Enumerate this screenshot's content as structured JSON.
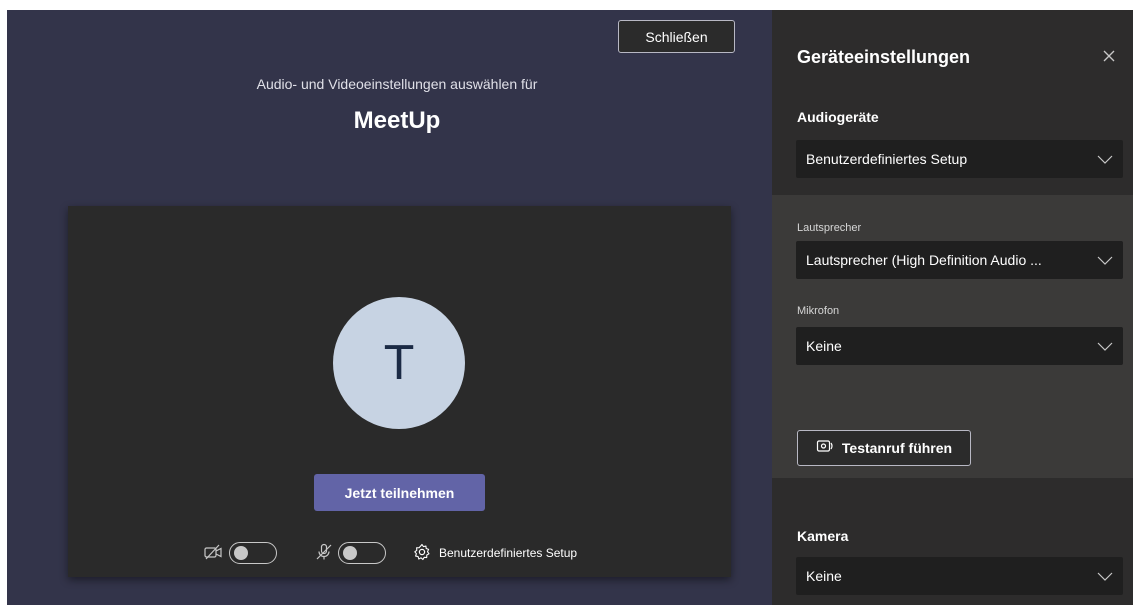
{
  "main": {
    "close_label": "Schließen",
    "subtitle": "Audio- und Videoeinstellungen auswählen für",
    "meeting_title": "MeetUp",
    "avatar_initial": "T",
    "join_label": "Jetzt teilnehmen",
    "camera_toggle": {
      "icon": "camera-off-icon",
      "on": false
    },
    "mic_toggle": {
      "icon": "mic-off-icon",
      "on": false
    },
    "setup_label": "Benutzerdefiniertes Setup",
    "setup_icon": "gear-icon"
  },
  "panel": {
    "title": "Geräteeinstellungen",
    "close_icon": "close-icon",
    "audio": {
      "label": "Audiogeräte",
      "value": "Benutzerdefiniertes Setup"
    },
    "speaker": {
      "label": "Lautsprecher",
      "value": "Lautsprecher (High Definition Audio ..."
    },
    "microphone": {
      "label": "Mikrofon",
      "value": "Keine"
    },
    "test_call_label": "Testanruf führen",
    "test_call_icon": "test-call-icon",
    "camera": {
      "label": "Kamera",
      "value": "Keine"
    }
  },
  "colors": {
    "main_bg": "#33344a",
    "panel_bg": "#2d2c2c",
    "sub_panel_bg": "#3b3a39",
    "accent": "#6264a7",
    "avatar_bg": "#c7d3e3",
    "avatar_text": "#1b2a45"
  }
}
